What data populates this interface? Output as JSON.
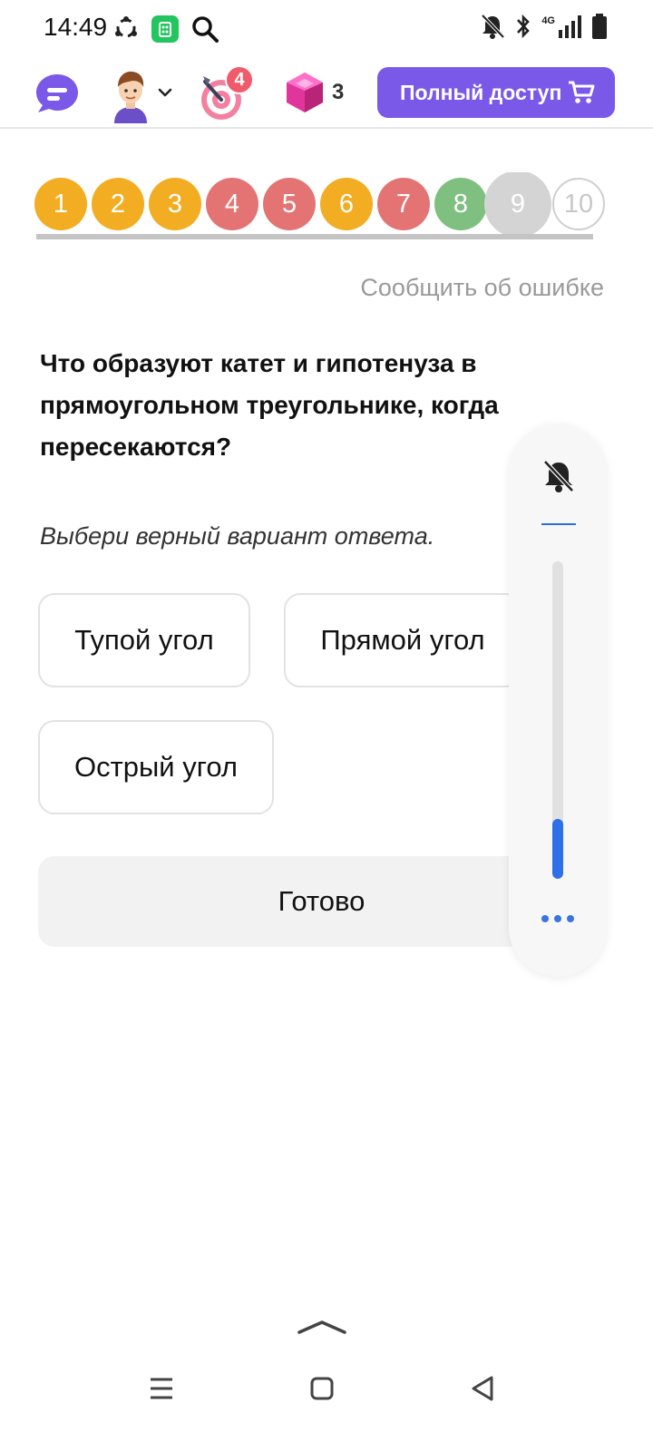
{
  "status_bar": {
    "time": "14:49",
    "icons": [
      "sync-icon",
      "app-store-icon",
      "search-icon",
      "bell-off-icon",
      "bluetooth-icon",
      "network-4g-icon",
      "signal-icon",
      "battery-icon"
    ],
    "network_label": "4G"
  },
  "header": {
    "chat_icon": "chat-bubble-icon",
    "avatar_icon": "avatar-icon",
    "target_badge": "4",
    "gems_count": "3",
    "full_access_label": "Полный доступ"
  },
  "questions": [
    {
      "number": "1",
      "color": "#f2ad22"
    },
    {
      "number": "2",
      "color": "#f2ad22"
    },
    {
      "number": "3",
      "color": "#f2ad22"
    },
    {
      "number": "4",
      "color": "#e47474"
    },
    {
      "number": "5",
      "color": "#e47474"
    },
    {
      "number": "6",
      "color": "#f2ad22"
    },
    {
      "number": "7",
      "color": "#e47474"
    },
    {
      "number": "8",
      "color": "#7fbf80"
    },
    {
      "number": "9",
      "color": "#d4d4d4"
    },
    {
      "number": "10",
      "color": "#ffffff"
    }
  ],
  "report_error": "Сообщить об ошибке",
  "question_text": "Что образуют катет и гипотенуза в прямоугольном треугольнике, когда пересекаются?",
  "instruction": "Выбери верный вариант ответа.",
  "answers": [
    {
      "label": "Тупой угол"
    },
    {
      "label": "Прямой угол"
    },
    {
      "label": "Острый угол"
    }
  ],
  "done_label": "Готово",
  "volume": {
    "level": 0.19,
    "accent": "#2f6fe8"
  },
  "colors": {
    "accent": "#7a58e8",
    "badge": "#f05a6a"
  }
}
